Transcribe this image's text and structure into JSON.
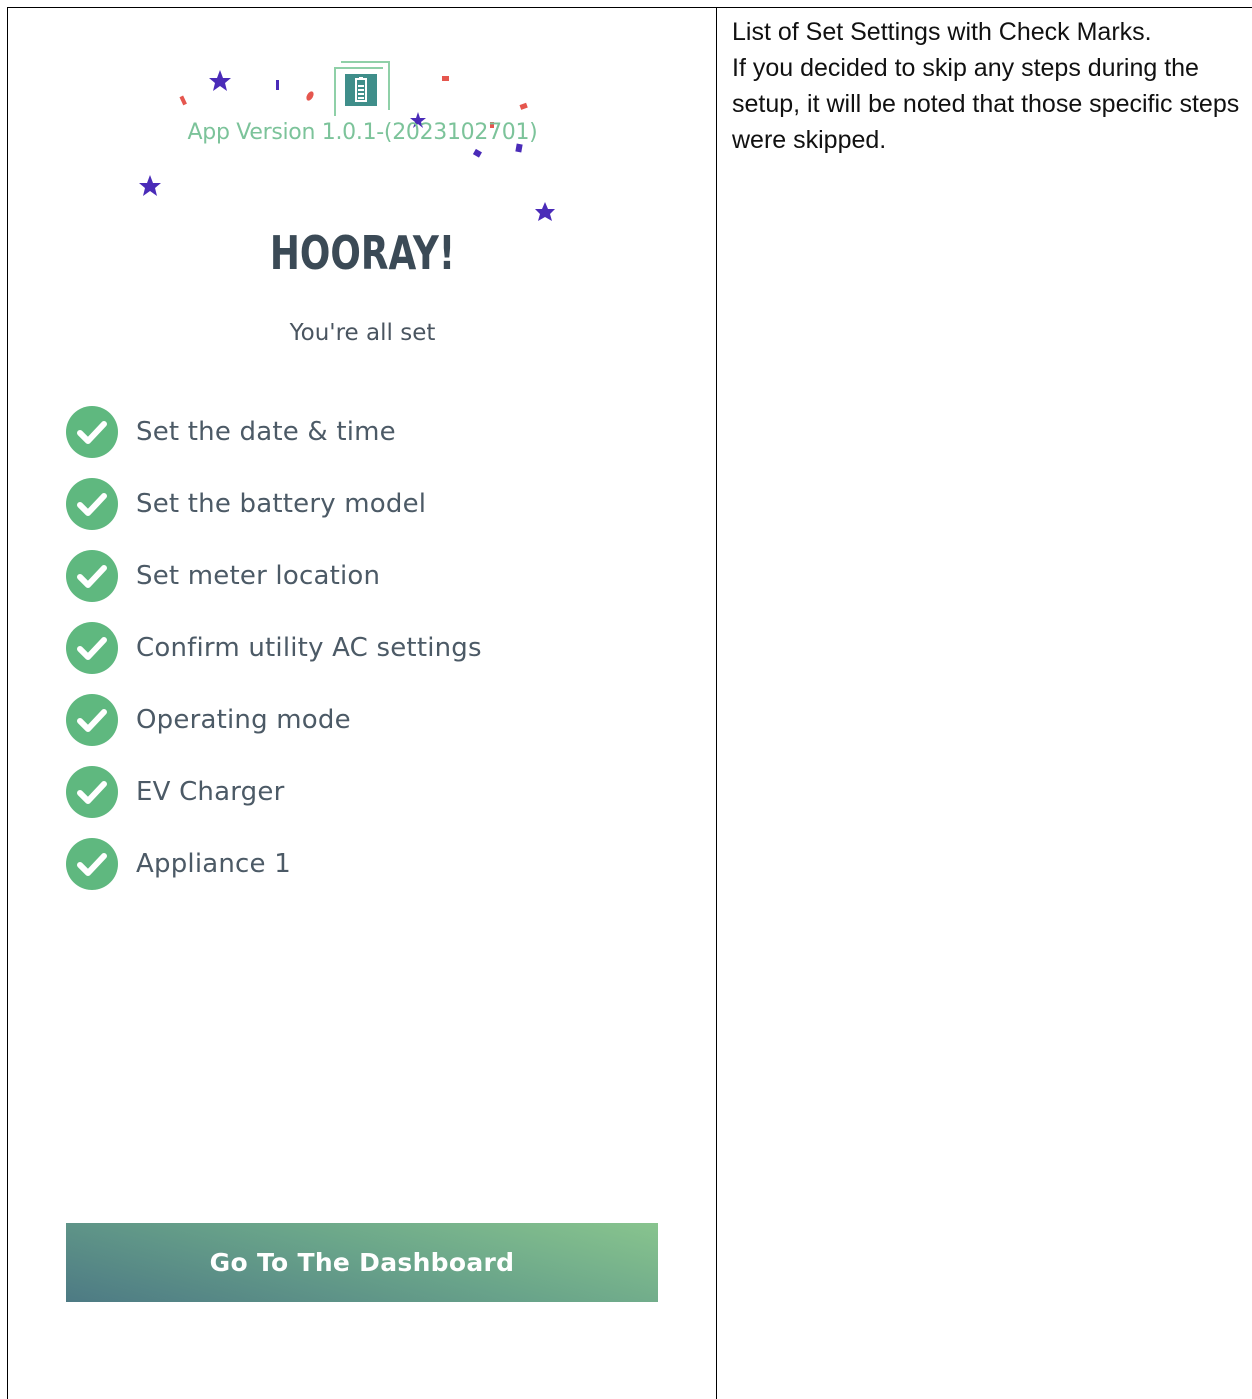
{
  "app": {
    "version_text": "App Version 1.0.1-(2023102701)",
    "logo_icon": "battery-icon",
    "accent_color": "#7cc39a"
  },
  "header": {
    "title": "HOORAY!",
    "subtitle": "You're all set"
  },
  "steps": [
    {
      "label": "Set the date & time",
      "status": "done"
    },
    {
      "label": "Set the battery model",
      "status": "done"
    },
    {
      "label": "Set meter location",
      "status": "done"
    },
    {
      "label": "Confirm utility AC settings",
      "status": "done"
    },
    {
      "label": "Operating mode",
      "status": "done"
    },
    {
      "label": "EV Charger",
      "status": "done"
    },
    {
      "label": "Appliance 1",
      "status": "done"
    }
  ],
  "check_color": "#5fb87f",
  "actions": {
    "dashboard_label": "Go To The Dashboard"
  },
  "description": {
    "line1": "List of Set Settings with Check Marks.",
    "line2": "If you decided to skip any steps during the setup, it will be noted that those specific steps were skipped."
  }
}
